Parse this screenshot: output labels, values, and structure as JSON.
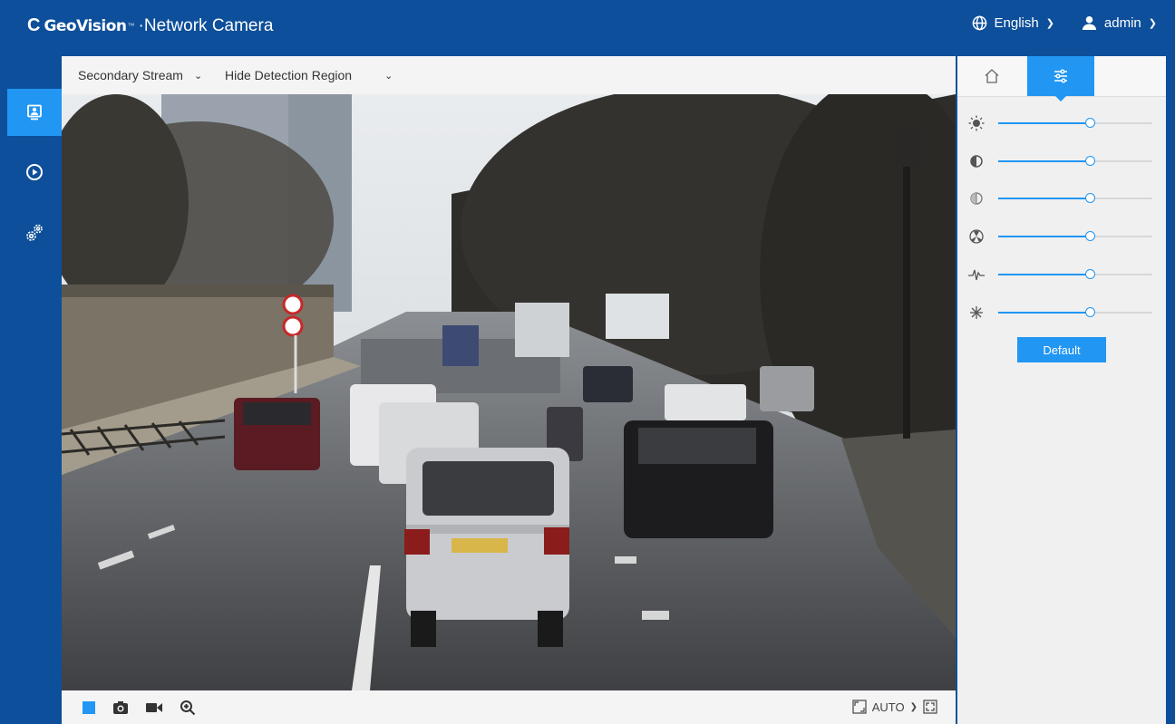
{
  "header": {
    "logo_mark": "C",
    "logo_text": "GeoVision",
    "logo_tm": "™",
    "product": "·Network Camera",
    "language": "English",
    "user": "admin"
  },
  "sidenav": {
    "items": [
      {
        "name": "live-view",
        "icon": "monitor-icon",
        "active": true
      },
      {
        "name": "playback",
        "icon": "play-circle-icon",
        "active": false
      },
      {
        "name": "settings",
        "icon": "gears-icon",
        "active": false
      }
    ]
  },
  "streambar": {
    "stream": "Secondary Stream",
    "detection": "Hide Detection Region"
  },
  "bottombar": {
    "icons": [
      "stop-icon",
      "snapshot-icon",
      "record-icon",
      "zoom-in-icon"
    ],
    "fit_icon": "fit-icon",
    "aspect": "AUTO",
    "fullscreen_icon": "fullscreen-icon"
  },
  "rightpanel": {
    "tabs": [
      "home-icon",
      "adjust-icon"
    ],
    "sliders": [
      {
        "name": "brightness",
        "icon": "brightness-icon",
        "value": 0.6
      },
      {
        "name": "contrast",
        "icon": "contrast-icon",
        "value": 0.6
      },
      {
        "name": "saturation",
        "icon": "saturation-icon",
        "value": 0.6
      },
      {
        "name": "sharpness",
        "icon": "sharpness-icon",
        "value": 0.6
      },
      {
        "name": "noise",
        "icon": "noise-icon",
        "value": 0.6
      },
      {
        "name": "backlight",
        "icon": "backlight-icon",
        "value": 0.6
      }
    ],
    "default_label": "Default"
  },
  "colors": {
    "brand": "#0d4f9a",
    "accent": "#2196f3"
  }
}
